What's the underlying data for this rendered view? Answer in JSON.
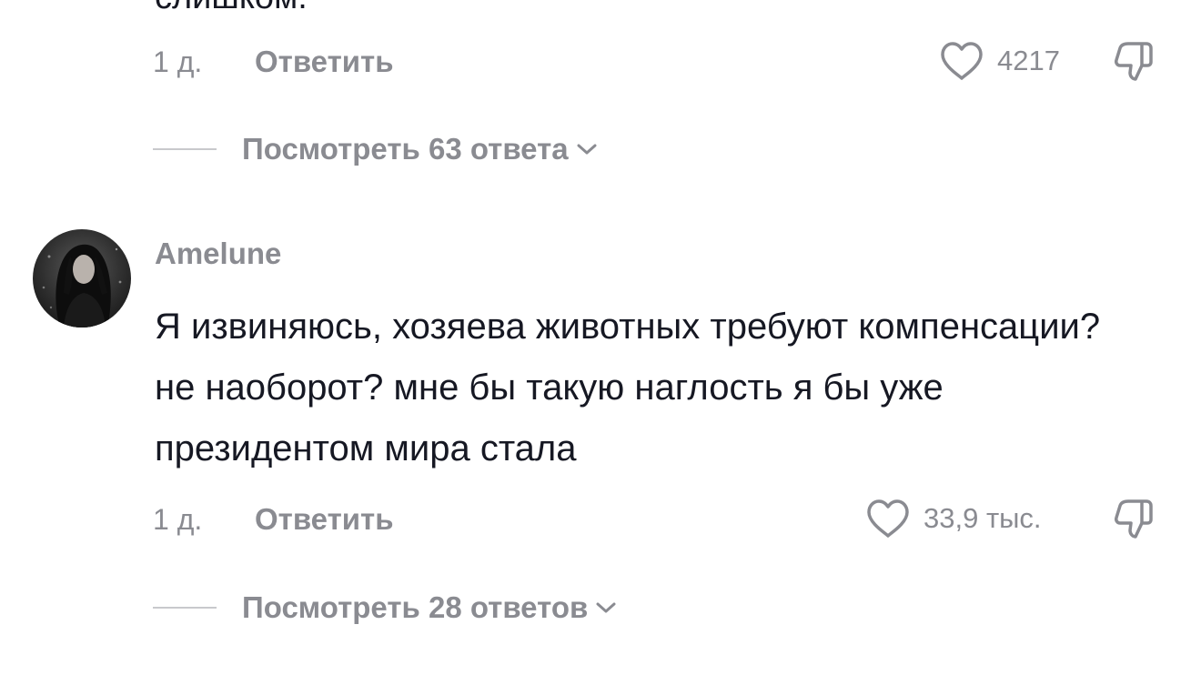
{
  "top_comment": {
    "text_cut": "слишком.",
    "time": "1 д.",
    "reply_label": "Ответить",
    "like_count": "4217",
    "view_replies": "Посмотреть 63 ответа"
  },
  "comment": {
    "username": "Amelune",
    "text": "Я извиняюсь, хозяева животных требуют компенсации? не наоборот? мне бы такую наглость я бы уже президентом мира стала",
    "time": "1 д.",
    "reply_label": "Ответить",
    "like_count": "33,9 тыс.",
    "view_replies": "Посмотреть 28 ответов"
  },
  "icons": {
    "like": "heart-outline-icon",
    "dislike": "thumbs-down-icon",
    "expand": "chevron-down-icon"
  },
  "colors": {
    "text_primary": "#161823",
    "text_secondary": "#8a8b91",
    "divider": "#c8c9cc"
  }
}
